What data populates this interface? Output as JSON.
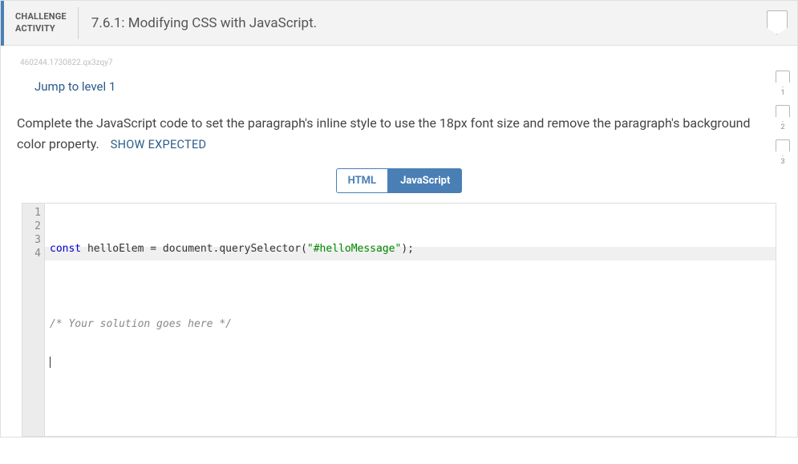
{
  "header": {
    "label_line1": "CHALLENGE",
    "label_line2": "ACTIVITY",
    "title": "7.6.1: Modifying CSS with JavaScript."
  },
  "small_id": "460244.1730822.qx3zqy7",
  "jump_link": "Jump to level 1",
  "instructions": "Complete the JavaScript code to set the paragraph's inline style to use the 18px font size and remove the paragraph's background color property.",
  "show_expected": "SHOW EXPECTED",
  "tabs": {
    "html": "HTML",
    "javascript": "JavaScript",
    "active": "javascript"
  },
  "code": {
    "line_numbers": [
      "1",
      "2",
      "3",
      "4"
    ],
    "lines": {
      "l1_kw": "const",
      "l1_rest": " helloElem = document.querySelector(",
      "l1_str": "\"#helloMessage\"",
      "l1_end": ");",
      "l3_cmt": "/* Your solution goes here */"
    }
  },
  "side_levels": [
    "1",
    "2",
    "3"
  ]
}
